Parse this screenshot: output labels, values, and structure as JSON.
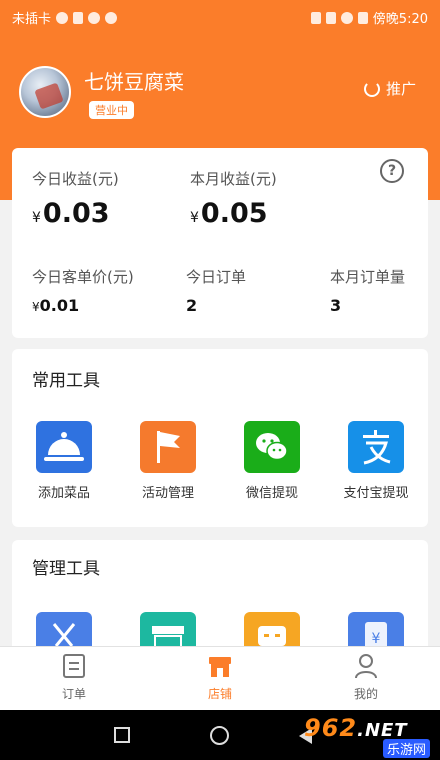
{
  "status_bar": {
    "carrier": "未插卡",
    "time": "傍晚5:20"
  },
  "header": {
    "store_name": "七饼豆腐菜",
    "status_badge": "营业中",
    "promote_label": "推广"
  },
  "stats": {
    "today_revenue": {
      "label": "今日收益(元)",
      "currency": "¥",
      "value": "0.03"
    },
    "month_revenue": {
      "label": "本月收益(元)",
      "currency": "¥",
      "value": "0.05"
    },
    "today_avg_price": {
      "label": "今日客单价(元)",
      "currency": "¥",
      "value": "0.01"
    },
    "today_orders": {
      "label": "今日订单",
      "value": "2"
    },
    "month_orders": {
      "label": "本月订单量",
      "value": "3"
    },
    "help_icon": "?"
  },
  "common_tools": {
    "title": "常用工具",
    "items": [
      {
        "label": "添加菜品",
        "icon": "cloche-icon",
        "color": "#2f72e0"
      },
      {
        "label": "活动管理",
        "icon": "flag-icon",
        "color": "#f57a2d"
      },
      {
        "label": "微信提现",
        "icon": "wechat-icon",
        "color": "#1aad19"
      },
      {
        "label": "支付宝提现",
        "icon": "alipay-icon",
        "color": "#1690e8"
      }
    ]
  },
  "manage_tools": {
    "title": "管理工具",
    "icons": [
      "fork-knife-icon",
      "storefront-icon",
      "chat-box-icon",
      "yuan-receipt-icon"
    ]
  },
  "bottom_nav": {
    "items": [
      {
        "label": "订单",
        "icon": "document-icon",
        "active": false
      },
      {
        "label": "店铺",
        "icon": "shop-icon",
        "active": true
      },
      {
        "label": "我的",
        "icon": "person-icon",
        "active": false
      }
    ],
    "accent": "#fb7d2a"
  },
  "watermark": {
    "main": "962",
    "suffix": ".NET",
    "sub": "乐游网"
  }
}
